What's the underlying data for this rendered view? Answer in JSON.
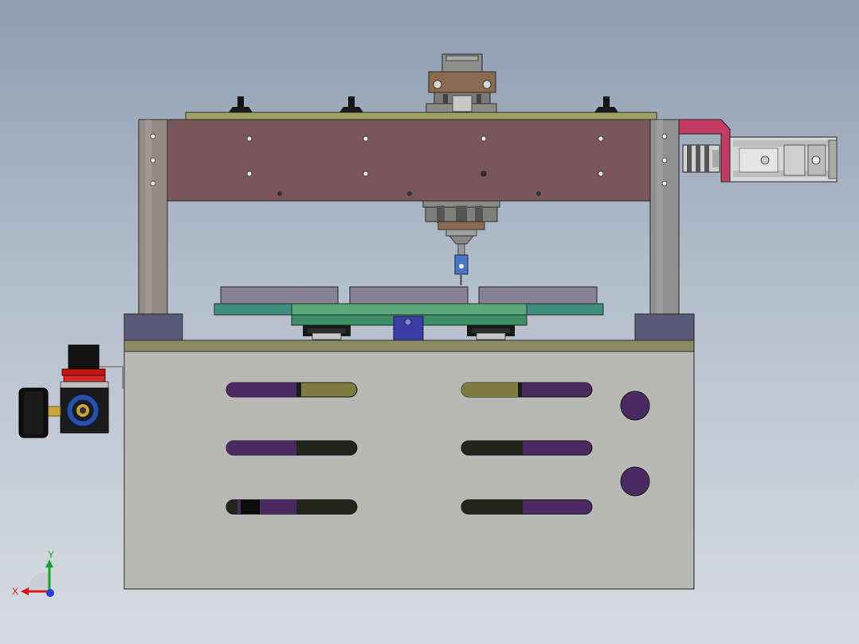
{
  "view": {
    "type": "cad-front-view",
    "background_top": "#8e9db2",
    "background_bottom": "#d6dce3"
  },
  "colors": {
    "frame_beam": "#78565a",
    "frame_columns": "#968a85",
    "base_body": "#b8b8b6",
    "base_top_strip": "#8d8b63",
    "column_feet": "#5a5a78",
    "top_plate": "#9ca063",
    "slot_purple": "#4a2a60",
    "slot_olive": "#7e7a42",
    "slot_dark": "#22251a",
    "side_bracket": "#c43b62",
    "fixture_plate": "#5aa87a",
    "fixture_plate_lower": "#3f8f66",
    "fixture_blocks": "#868196",
    "regulator_red": "#c41414",
    "regulator_blue": "#2a4fa8"
  },
  "icons": {
    "triad": "coordinate-triad-icon"
  },
  "triad": {
    "x_label": "X",
    "y_label": "Y"
  }
}
